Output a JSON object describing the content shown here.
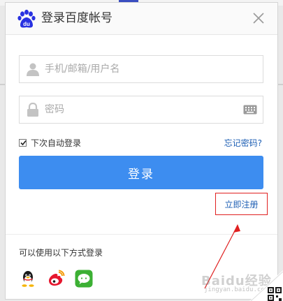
{
  "dialog": {
    "title": "登录百度帐号",
    "logo_text": "du"
  },
  "fields": {
    "username_placeholder": "手机/邮箱/用户名",
    "password_placeholder": "密码"
  },
  "remember": {
    "label": "下次自动登录",
    "checked": true
  },
  "links": {
    "forgot": "忘记密码?",
    "register": "立即注册"
  },
  "login_button": "登录",
  "alt_login": {
    "label": "可以使用以下方式登录",
    "providers": [
      "qq-icon",
      "weibo-icon",
      "wechat-icon"
    ]
  },
  "watermark": {
    "text": "Baidu经验",
    "sub": "jingyan.baidu.com"
  },
  "colors": {
    "primary": "#3d8df0",
    "link": "#1e5fb4",
    "annotation": "#e02020",
    "logo": "#2932e1"
  }
}
